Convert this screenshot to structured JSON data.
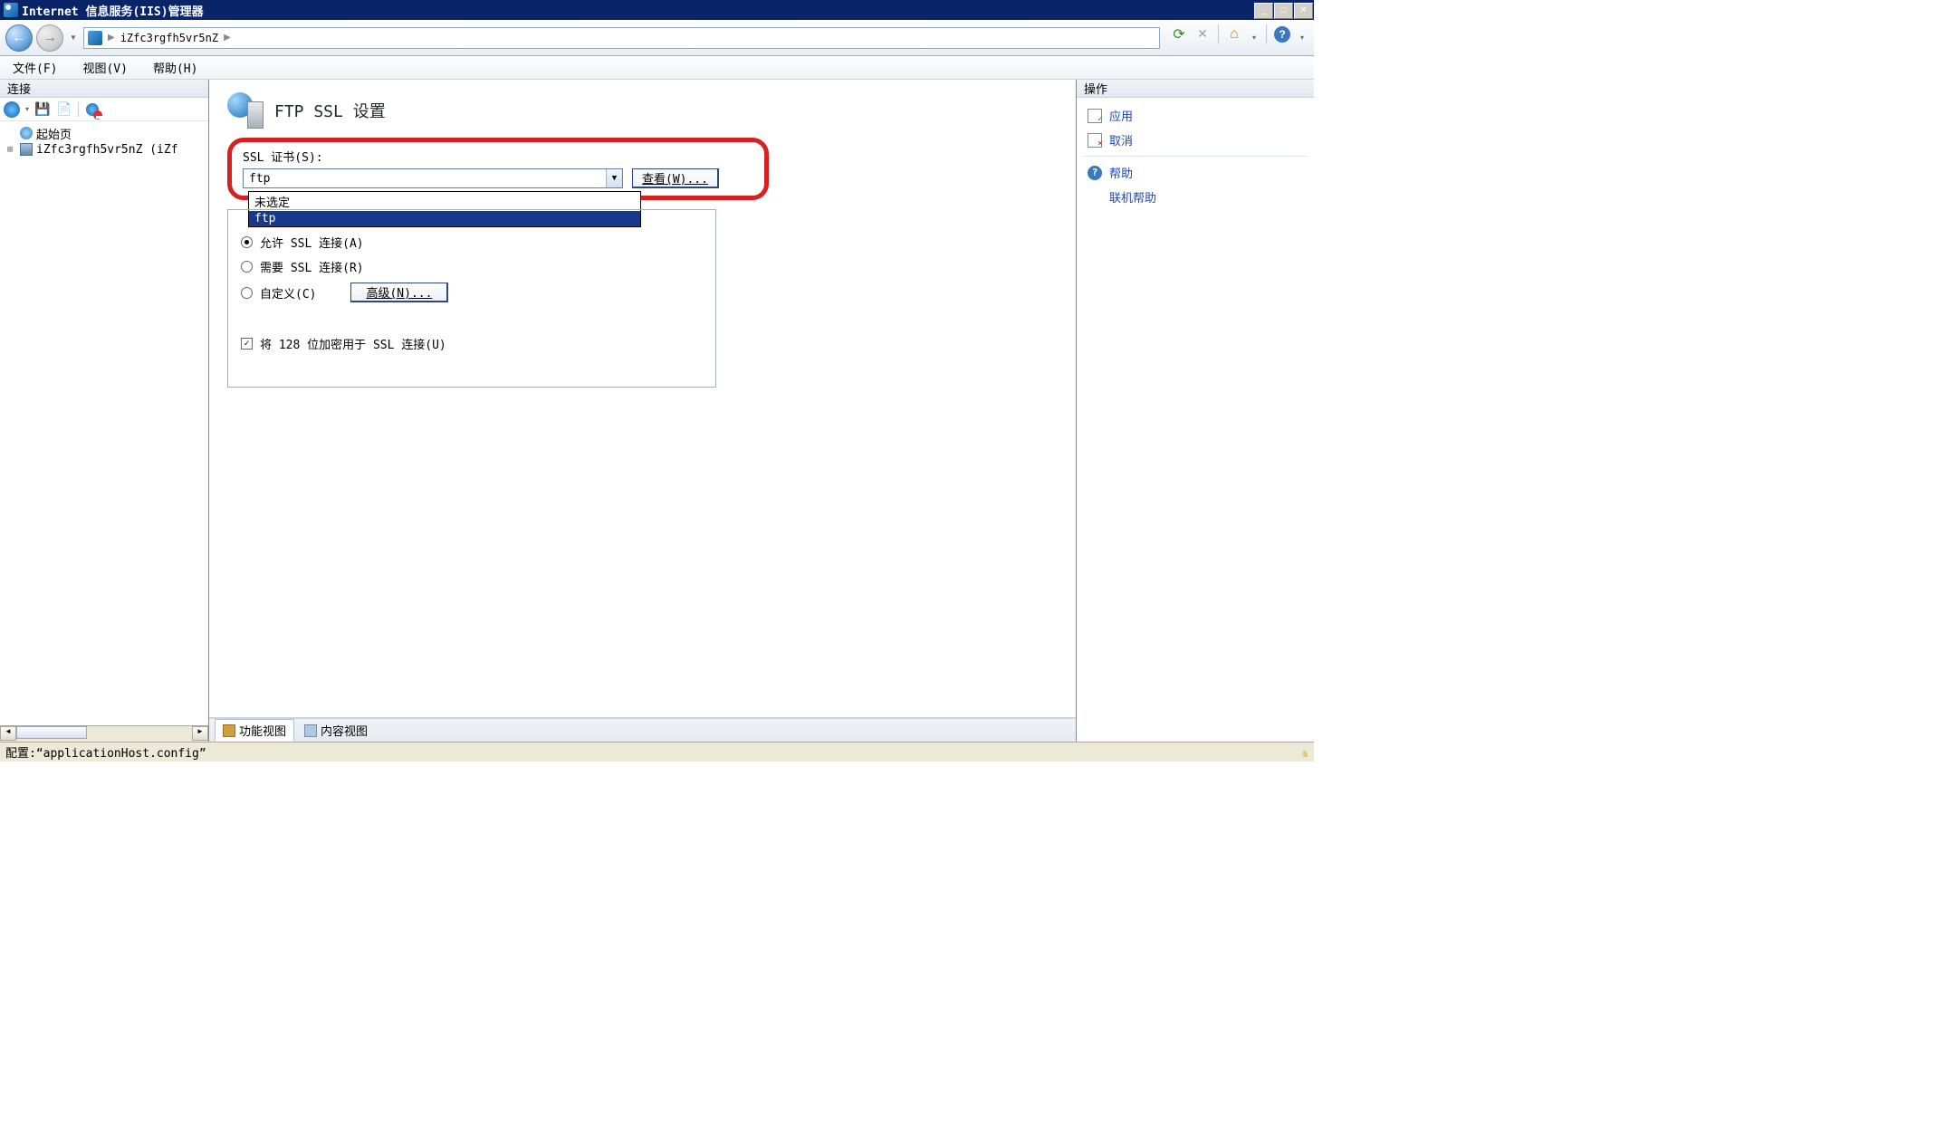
{
  "titlebar": {
    "text": "Internet 信息服务(IIS)管理器"
  },
  "nav": {
    "breadcrumb_server": "iZfc3rgfh5vr5nZ",
    "breadcrumb_sep": "▶"
  },
  "menu": {
    "file": "文件(F)",
    "view": "视图(V)",
    "help": "帮助(H)"
  },
  "left": {
    "header": "连接",
    "start_page": "起始页",
    "server": "iZfc3rgfh5vr5nZ (iZf"
  },
  "center": {
    "title": "FTP SSL 设置",
    "cert_label": "SSL 证书(S):",
    "dropdown_value": "ftp",
    "dropdown_opt_none": "未选定",
    "dropdown_opt_ftp": "ftp",
    "view_btn": "查看(W)...",
    "radio_allow": "允许 SSL 连接(A)",
    "radio_require": "需要 SSL 连接(R)",
    "radio_custom": "自定义(C)",
    "advanced_btn": "高级(N)...",
    "check_128": "将 128 位加密用于 SSL 连接(U)",
    "tab_features": "功能视图",
    "tab_content": "内容视图"
  },
  "right": {
    "header": "操作",
    "apply": "应用",
    "cancel": "取消",
    "help": "帮助",
    "online_help": "联机帮助"
  },
  "status": {
    "config": "配置:“applicationHost.config”"
  }
}
